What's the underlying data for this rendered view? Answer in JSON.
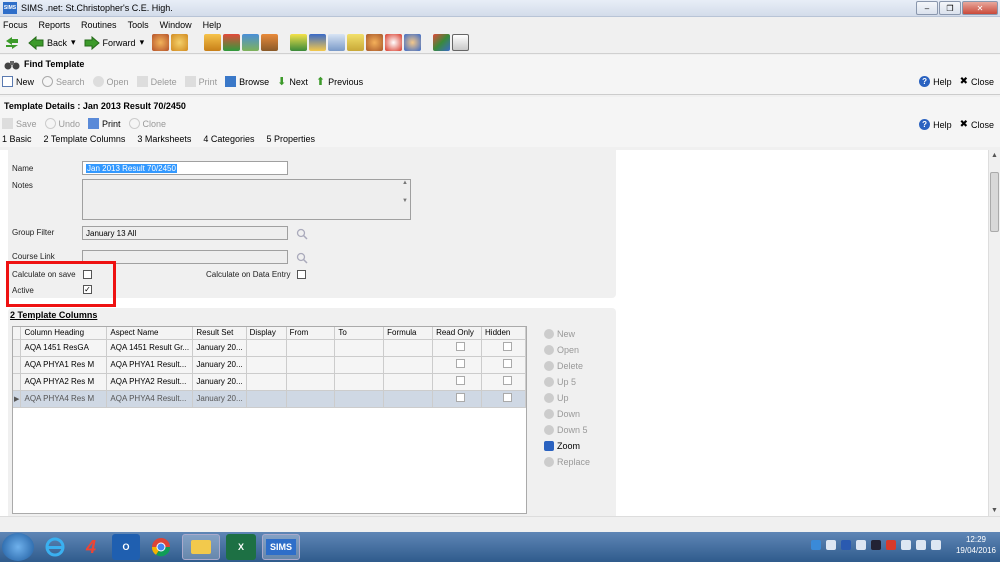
{
  "window": {
    "title": "SIMS .net: St.Christopher's C.E. High.",
    "app_badge": "SIMS"
  },
  "menu": [
    "Focus",
    "Reports",
    "Routines",
    "Tools",
    "Window",
    "Help"
  ],
  "toolbar": {
    "back_label": "Back",
    "forward_label": "Forward"
  },
  "find": {
    "title": "Find Template",
    "actions": {
      "new": "New",
      "search": "Search",
      "open": "Open",
      "delete": "Delete",
      "print": "Print",
      "browse": "Browse",
      "next": "Next",
      "previous": "Previous"
    },
    "help": "Help",
    "close": "Close"
  },
  "details": {
    "title": "Template Details : Jan 2013 Result 70/2450",
    "actions": {
      "save": "Save",
      "undo": "Undo",
      "print": "Print",
      "clone": "Clone"
    },
    "help": "Help",
    "close": "Close",
    "tabs": [
      "1 Basic",
      "2 Template Columns",
      "3 Marksheets",
      "4 Categories",
      "5 Properties"
    ]
  },
  "basic": {
    "name_label": "Name",
    "name_value": "Jan 2013 Result 70/2450",
    "notes_label": "Notes",
    "group_filter_label": "Group Filter",
    "group_filter_value": "January 13 All",
    "course_link_label": "Course Link",
    "calc_on_save_label": "Calculate on save",
    "calc_on_save_checked": false,
    "calc_on_entry_label": "Calculate on Data Entry",
    "calc_on_entry_checked": false,
    "active_label": "Active",
    "active_checked": true
  },
  "columns": {
    "section_title": "2 Template Columns",
    "headers": [
      "Column Heading",
      "Aspect Name",
      "Result Set",
      "Display",
      "From",
      "To",
      "Formula",
      "Read Only",
      "Hidden"
    ],
    "rows": [
      [
        "AQA 1451 ResGA",
        "AQA 1451 Result Gr...",
        "January 20...",
        "",
        "",
        "",
        ""
      ],
      [
        "AQA PHYA1 Res M",
        "AQA PHYA1 Result...",
        "January 20...",
        "",
        "",
        "",
        ""
      ],
      [
        "AQA PHYA2 Res M",
        "AQA PHYA2 Result...",
        "January 20...",
        "",
        "",
        "",
        ""
      ],
      [
        "AQA PHYA4 Res M",
        "AQA PHYA4 Result...",
        "January 20...",
        "",
        "",
        "",
        ""
      ]
    ],
    "side_actions": [
      {
        "label": "New",
        "enabled": false
      },
      {
        "label": "Open",
        "enabled": false
      },
      {
        "label": "Delete",
        "enabled": false
      },
      {
        "label": "Up 5",
        "enabled": false
      },
      {
        "label": "Up",
        "enabled": false
      },
      {
        "label": "Down",
        "enabled": false
      },
      {
        "label": "Down 5",
        "enabled": false
      },
      {
        "label": "Zoom",
        "enabled": true
      },
      {
        "label": "Replace",
        "enabled": false
      }
    ]
  },
  "taskbar": {
    "sims_label": "SIMS",
    "time": "12:29",
    "date": "19/04/2016"
  }
}
